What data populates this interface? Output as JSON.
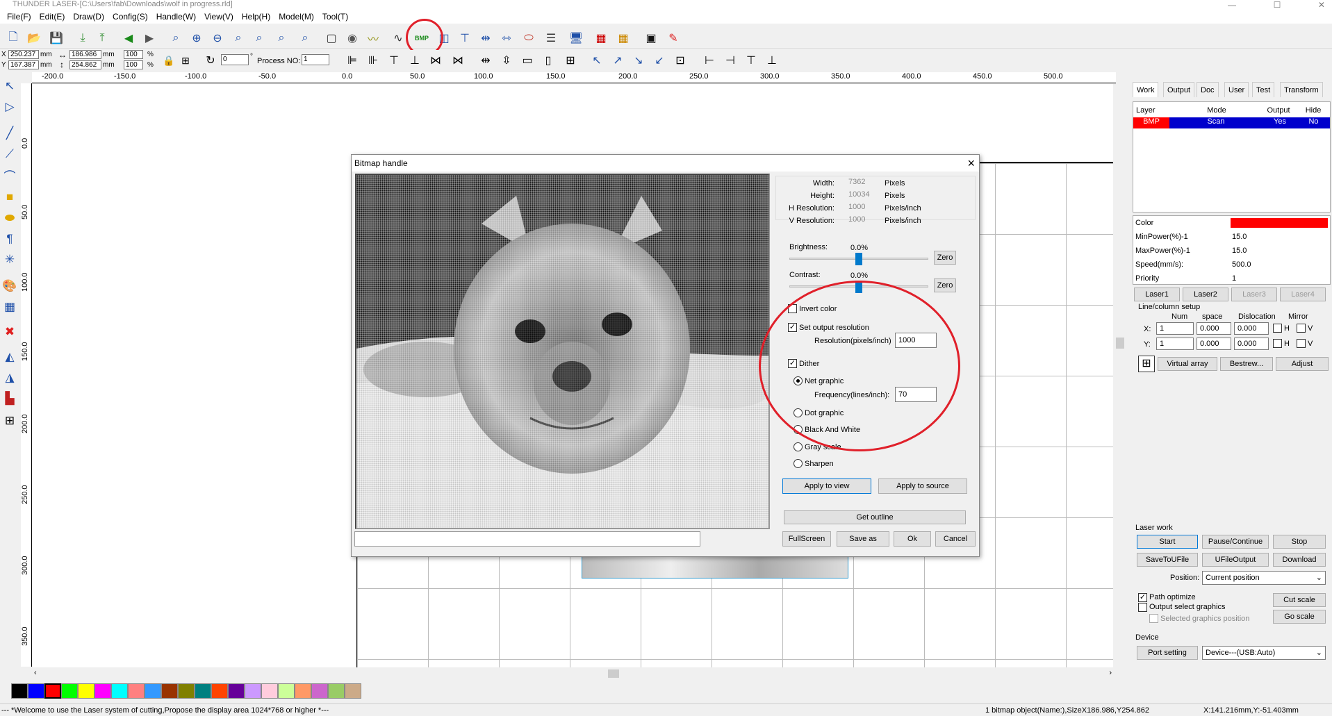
{
  "window": {
    "title": "THUNDER LASER-[C:\\Users\\fab\\Downloads\\wolf in progress.rld]",
    "minimize": "—",
    "maximize": "☐",
    "close": "✕"
  },
  "menu": [
    "File(F)",
    "Edit(E)",
    "Draw(D)",
    "Config(S)",
    "Handle(W)",
    "View(V)",
    "Help(H)",
    "Model(M)",
    "Tool(T)"
  ],
  "toolbar1": [
    "new-file-icon",
    "open-folder-icon",
    "save-icon",
    "import-icon",
    "export-icon",
    "undo-icon",
    "redo-icon",
    "zoom-icon",
    "zoom-in-icon",
    "zoom-out-icon",
    "zoom-page-icon",
    "zoom-select-icon",
    "zoom-fit-icon",
    "pan-icon",
    "select-rect-icon",
    "node-icon",
    "curve-smooth-icon",
    "curve-icon",
    "bmp-icon",
    "frame-icon",
    "tree-icon",
    "dimension-icon",
    "measure-icon",
    "cut-icon",
    "list-icon",
    "monitor-icon",
    "grid-red-icon",
    "grid-yellow-icon",
    "camera-icon",
    "laser-pen-icon"
  ],
  "bmp_label": "BMP",
  "toolbar2": {
    "x_label": "X",
    "y_label": "Y",
    "x_value": "250.237",
    "y_value": "167.387",
    "unit_mm": "mm",
    "width_value": "186.986",
    "height_value": "254.862",
    "scale_x": "100",
    "scale_y": "100",
    "percent": "%",
    "angle_value": "0",
    "degree": "°",
    "process_label": "Process NO:",
    "process_value": "1"
  },
  "ruler_h": [
    "-200.0",
    "-150.0",
    "-100.0",
    "-50.0",
    "0.0",
    "50.0",
    "100.0",
    "150.0",
    "200.0",
    "250.0",
    "300.0",
    "350.0",
    "400.0",
    "450.0",
    "500.0"
  ],
  "ruler_v": [
    "0.0",
    "50.0",
    "100.0",
    "150.0",
    "200.0",
    "250.0",
    "300.0",
    "350.0"
  ],
  "palette": [
    "#000000",
    "#0000ff",
    "#ff0000",
    "#00ff00",
    "#ffff00",
    "#ff00ff",
    "#00ffff",
    "#ff8080",
    "#3399ff",
    "#993300",
    "#808000",
    "#008080",
    "#ff4400",
    "#660099",
    "#cc99ff",
    "#ffccdd",
    "#ccff99",
    "#ff9966",
    "#cc66cc",
    "#99cc66",
    "#ccaa88"
  ],
  "status": {
    "left": "--- *Welcome to use the Laser system of cutting,Propose the display area 1024*768 or higher *---",
    "middle": "1 bitmap object(Name:),SizeX186.986,Y254.862",
    "right": "X:141.216mm,Y:-51.403mm"
  },
  "right_panel": {
    "tabs": [
      "Work",
      "Output",
      "Doc",
      "User",
      "Test",
      "Transform"
    ],
    "columns": [
      "Layer",
      "Mode",
      "Output",
      "Hide"
    ],
    "row": {
      "layer": "BMP",
      "mode": "Scan",
      "output": "Yes",
      "hide": "No"
    },
    "props": [
      {
        "label": "Color",
        "value": ""
      },
      {
        "label": "MinPower(%)-1",
        "value": "15.0"
      },
      {
        "label": "MaxPower(%)-1",
        "value": "15.0"
      },
      {
        "label": "Speed(mm/s):",
        "value": "500.0"
      },
      {
        "label": "Priority",
        "value": "1"
      }
    ],
    "laser_tabs": [
      "Laser1",
      "Laser2",
      "Laser3",
      "Laser4"
    ],
    "line_col_title": "Line/column setup",
    "lc_headers": [
      "Num",
      "space",
      "Dislocation",
      "Mirror"
    ],
    "x_row": {
      "label": "X:",
      "num": "1",
      "space": "0.000",
      "disloc": "0.000",
      "mirror": "H",
      "mirror2": "V"
    },
    "y_row": {
      "label": "Y:",
      "num": "1",
      "space": "0.000",
      "disloc": "0.000",
      "mirror": "H",
      "mirror2": "V"
    },
    "buttons": [
      "Virtual array",
      "Bestrew...",
      "Adjust"
    ]
  },
  "laser_work": {
    "title": "Laser work",
    "buttons": [
      "Start",
      "Pause/Continue",
      "Stop",
      "SaveToUFile",
      "UFileOutput",
      "Download"
    ],
    "position_label": "Position:",
    "position_value": "Current position",
    "path_optimize": "Path optimize",
    "output_select": "Output select graphics",
    "selected_position": "Selected graphics position",
    "cut_scale": "Cut scale",
    "go_scale": "Go scale",
    "device_title": "Device",
    "port_setting": "Port setting",
    "device_value": "Device---(USB:Auto)"
  },
  "dialog": {
    "title": "Bitmap handle",
    "info": [
      {
        "label": "Width:",
        "value": "7362",
        "unit": "Pixels"
      },
      {
        "label": "Height:",
        "value": "10034",
        "unit": "Pixels"
      },
      {
        "label": "H Resolution:",
        "value": "1000",
        "unit": "Pixels/inch"
      },
      {
        "label": "V Resolution:",
        "value": "1000",
        "unit": "Pixels/inch"
      }
    ],
    "brightness_label": "Brightness:",
    "brightness_value": "0.0%",
    "contrast_label": "Contrast:",
    "contrast_value": "0.0%",
    "zero": "Zero",
    "invert": "Invert color",
    "set_output": "Set output resolution",
    "resolution_label": "Resolution(pixels/inch)",
    "resolution_value": "1000",
    "dither": "Dither",
    "net_graphic": "Net graphic",
    "frequency_label": "Frequency(lines/inch):",
    "frequency_value": "70",
    "dot_graphic": "Dot graphic",
    "black_white": "Black And White",
    "gray_scale": "Gray scale",
    "sharpen": "Sharpen",
    "apply_view": "Apply to view",
    "apply_source": "Apply to source",
    "get_outline": "Get outline",
    "fullscreen": "FullScreen",
    "save_as": "Save as",
    "ok": "Ok",
    "cancel": "Cancel"
  }
}
